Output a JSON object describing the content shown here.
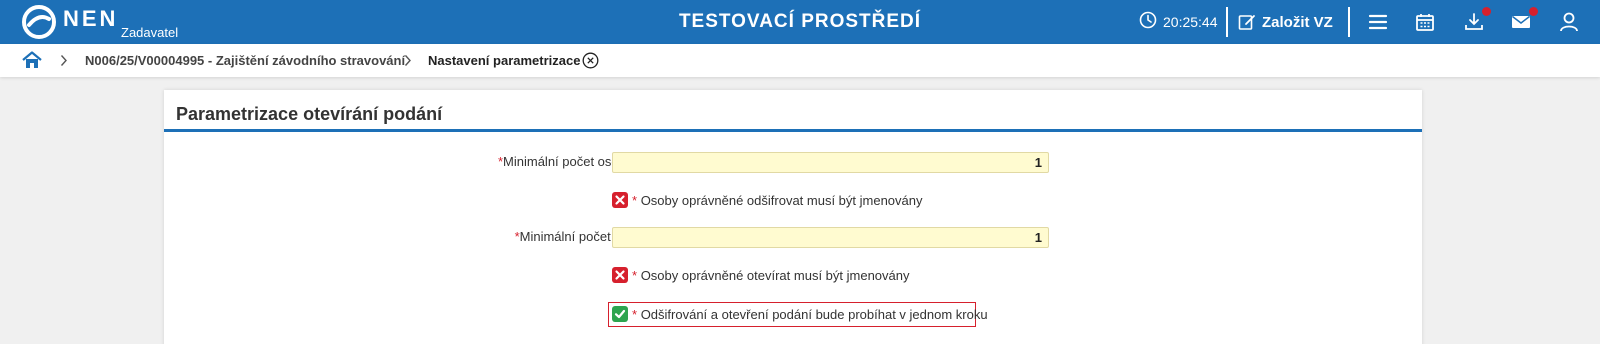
{
  "header": {
    "logo_text": "NEN",
    "logo_subtitle": "Zadavatel",
    "environment_title": "TESTOVACÍ PROSTŘEDÍ",
    "time": "20:25:44",
    "create_label": "Založit VZ",
    "icons": [
      "clock-icon",
      "edit-icon",
      "menu-icon",
      "calendar-icon",
      "download-icon",
      "mail-icon",
      "user-icon"
    ],
    "brand_color": "#1d70b7",
    "notification_color": "#d6202d"
  },
  "breadcrumb": {
    "items": [
      "N006/25/V00004995 - Zajištění závodního stravování",
      "Nastavení parametrizace"
    ]
  },
  "panel": {
    "title": "Parametrizace otevírání podání",
    "fields": [
      {
        "required_mark": "*",
        "label": "Minimální počet osob potřebný k odšifrování:",
        "value": "1"
      },
      {
        "required_mark": "*",
        "label": "Minimální počet osob potřebný k otevření:",
        "value": "1"
      }
    ],
    "statuses": [
      {
        "state": "error",
        "required_mark": "*",
        "text": "Osoby oprávněné odšifrovat musí být jmenovány"
      },
      {
        "state": "error",
        "required_mark": "*",
        "text": "Osoby oprávněné otevírat musí být jmenovány"
      },
      {
        "state": "ok",
        "required_mark": "*",
        "text": "Odšifrování a otevření podání bude probíhat v jednom kroku"
      }
    ],
    "error_color": "#d6202d",
    "ok_color": "#2ea44f"
  }
}
